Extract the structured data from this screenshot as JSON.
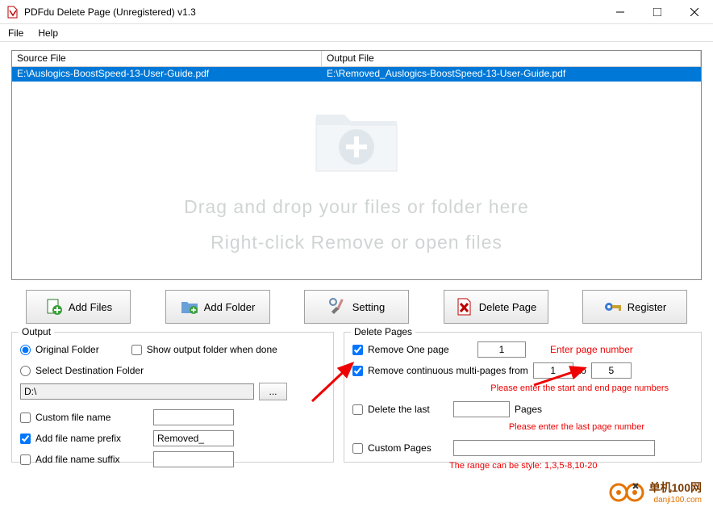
{
  "title": "PDFdu Delete Page (Unregistered) v1.3",
  "menu": {
    "file": "File",
    "help": "Help"
  },
  "filelist": {
    "h_source": "Source File",
    "h_output": "Output File",
    "rows": [
      {
        "source": "E:\\Auslogics-BoostSpeed-13-User-Guide.pdf",
        "output": "E:\\Removed_Auslogics-BoostSpeed-13-User-Guide.pdf"
      }
    ]
  },
  "dropzone": {
    "line1": "Drag and drop your files or folder here",
    "line2": "Right-click Remove or open files"
  },
  "toolbar": {
    "add_files": "Add Files",
    "add_folder": "Add Folder",
    "setting": "Setting",
    "delete_page": "Delete Page",
    "register": "Register"
  },
  "output": {
    "title": "Output",
    "original": "Original Folder",
    "dest": "Select Destination Folder",
    "show_done": "Show output folder when done",
    "path": "D:\\",
    "custom_name": "Custom file name",
    "prefix_label": "Add file name prefix",
    "prefix_val": "Removed_",
    "suffix_label": "Add file name suffix"
  },
  "delete": {
    "title": "Delete Pages",
    "one_label": "Remove One page",
    "one_val": "1",
    "one_hint": "Enter page number",
    "multi_label": "Remove continuous multi-pages  from",
    "multi_from": "1",
    "multi_to_label": "to",
    "multi_to": "5",
    "multi_hint": "Please enter the start and end page numbers",
    "last_label": "Delete the last",
    "last_unit": "Pages",
    "last_hint": "Please enter the last page number",
    "custom_label": "Custom Pages",
    "custom_hint": "The range can be style:  1,3,5-8,10-20"
  },
  "watermark": {
    "cn": "单机100网",
    "url": "danji100.com"
  }
}
